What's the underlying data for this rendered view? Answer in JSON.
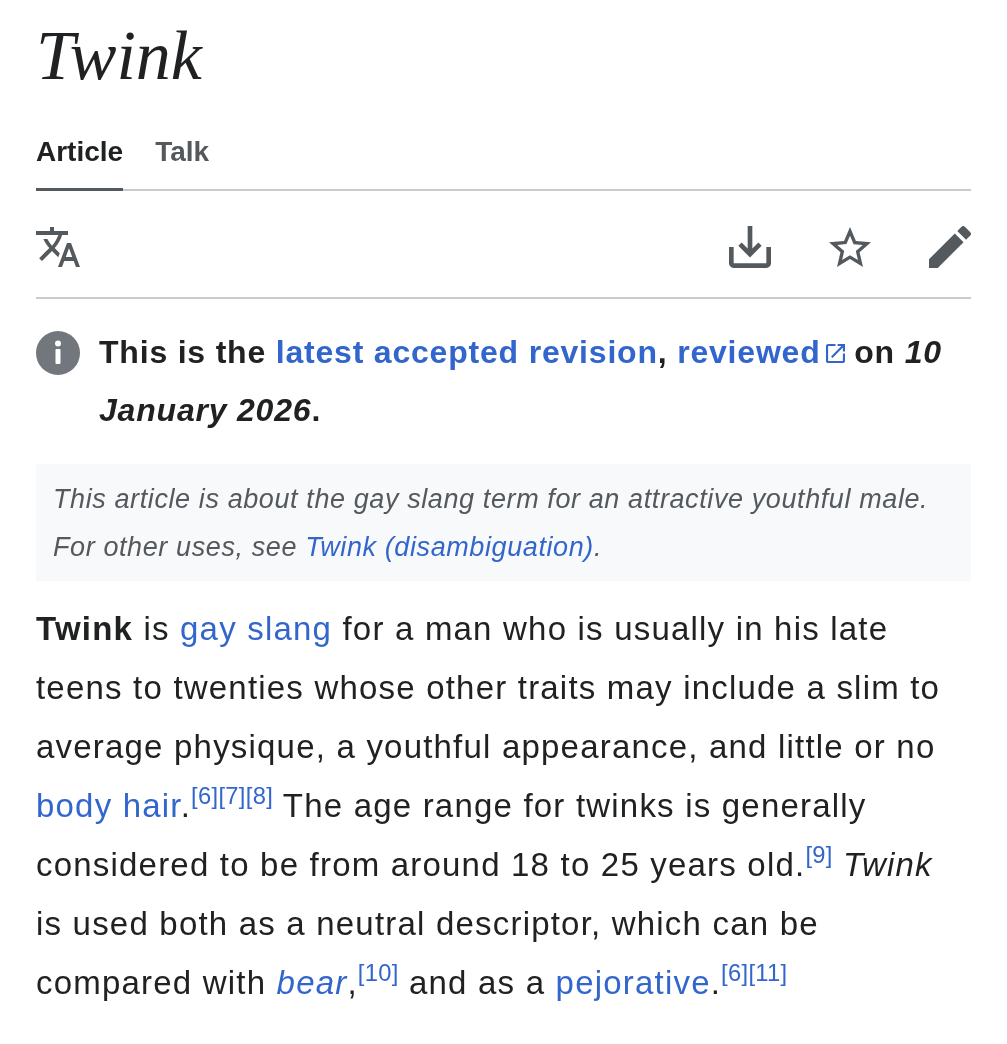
{
  "page": {
    "title": "Twink"
  },
  "tabs": [
    {
      "label": "Article",
      "selected": true
    },
    {
      "label": "Talk",
      "selected": false
    }
  ],
  "revision_notice": {
    "segments": [
      {
        "kind": "text",
        "text": "This is the "
      },
      {
        "kind": "link",
        "text": "latest accepted revision"
      },
      {
        "kind": "text",
        "text": ", "
      },
      {
        "kind": "external_link",
        "text": "reviewed"
      },
      {
        "kind": "text",
        "text": " on *10 January 2026*."
      }
    ]
  },
  "hatnote": {
    "segments": [
      {
        "kind": "text",
        "text": "This article is about the gay slang term for an attractive youthful male. For other uses, see "
      },
      {
        "kind": "link",
        "text": "Twink (disambiguation)"
      },
      {
        "kind": "text",
        "text": "."
      }
    ]
  },
  "article_paragraph": {
    "segments": [
      {
        "kind": "text",
        "text": "**Twink** is "
      },
      {
        "kind": "link",
        "text": "gay slang"
      },
      {
        "kind": "text",
        "text": " for a man who is usually in his late teens to twenties whose other traits may include a slim to average physique, a youthful appearance, and little or no "
      },
      {
        "kind": "link",
        "text": "body hair"
      },
      {
        "kind": "text",
        "text": "."
      },
      {
        "kind": "ref",
        "text": "[6]"
      },
      {
        "kind": "ref",
        "text": "[7]"
      },
      {
        "kind": "ref",
        "text": "[8]"
      },
      {
        "kind": "text",
        "text": " The age range for twinks is generally considered to be from around 18 to 25 years old."
      },
      {
        "kind": "ref",
        "text": "[9]"
      },
      {
        "kind": "text",
        "text": " *Twink* is used both as a neutral descriptor, which can be compared with "
      },
      {
        "kind": "link",
        "text": "*bear*"
      },
      {
        "kind": "text",
        "text": ","
      },
      {
        "kind": "ref",
        "text": "[10]"
      },
      {
        "kind": "text",
        "text": " and as a "
      },
      {
        "kind": "link",
        "text": "pejorative"
      },
      {
        "kind": "text",
        "text": "."
      },
      {
        "kind": "ref",
        "text": "[6]"
      },
      {
        "kind": "ref",
        "text": "[11]"
      }
    ]
  }
}
